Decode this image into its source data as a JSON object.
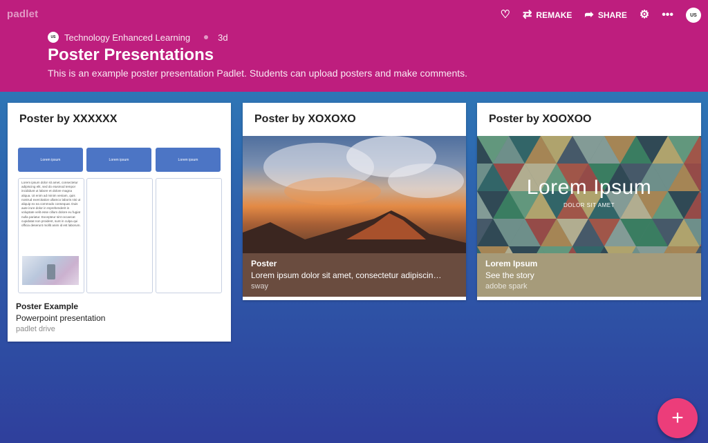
{
  "app": {
    "brand": "padlet"
  },
  "toolbar": {
    "remake_label": "REMAKE",
    "share_label": "SHARE",
    "avatar_text": "US"
  },
  "header": {
    "owner": "Technology Enhanced Learning",
    "owner_avatar_text": "US",
    "age": "3d",
    "title": "Poster Presentations",
    "subtitle": "This is an example poster presentation Padlet. Students can upload posters and make comments.",
    "colors": {
      "header_bg": "#be1e7e",
      "fab": "#ec3d7a"
    }
  },
  "posts": [
    {
      "heading": "Poster by XXXXXX",
      "attachment_title": "Poster Example",
      "attachment_text": "Powerpoint presentation",
      "attachment_source": "padlet drive",
      "thumb": {
        "col_headers": [
          "Lorem ipsum",
          "Lorem ipsum",
          "Lorem ipsum"
        ],
        "body_text": "Lorem ipsum dolor sit amet, consectetur adipiscing elit, sed do eiusmod tempor incididunt ut labore et dolore magna aliqua. Ut enim ad minim veniam, quis nostrud exercitation ullamco laboris nisi ut aliquip ex ea commodo consequat. Duis aute irure dolor in reprehenderit in voluptate velit esse cillum dolore eu fugiat nulla pariatur. Excepteur sint occaecat cupidatat non proident, sunt in culpa qui officia deserunt mollit anim id est laborum."
      }
    },
    {
      "heading": "Poster by XOXOXO",
      "attachment_title": "Poster",
      "attachment_text": "Lorem ipsum dolor sit amet, consectetur adipiscin…",
      "attachment_source": "sway",
      "caption_bg": "#6a4c3f"
    },
    {
      "heading": "Poster by XOOXOO",
      "attachment_title": "Lorem Ipsum",
      "attachment_text": "See the story",
      "attachment_source": "adobe spark",
      "caption_bg": "#a69b7a",
      "graphic_title": "Lorem Ipsum",
      "graphic_subtitle": "DOLOR SIT AMET"
    }
  ],
  "fab": {
    "icon": "plus-icon",
    "label": "+"
  }
}
